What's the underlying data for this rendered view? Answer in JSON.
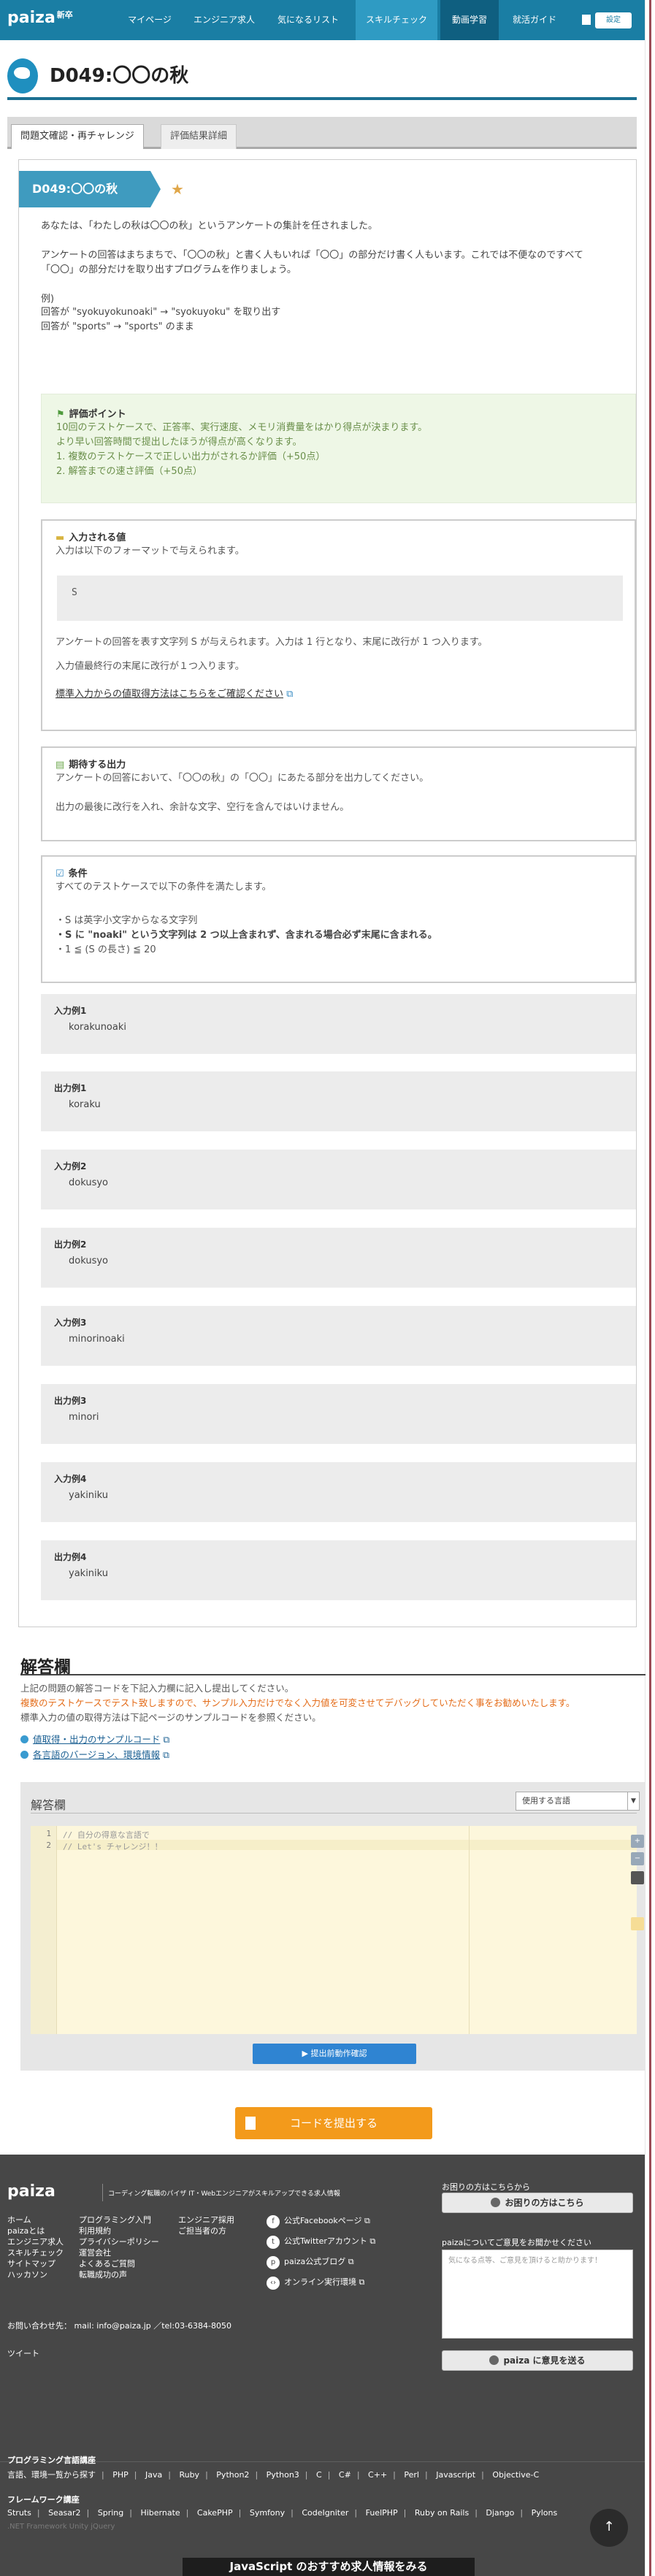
{
  "nav": {
    "logo": "paiza",
    "logo_sub": "新卒",
    "items": [
      "マイページ",
      "エンジニア求人",
      "気になるリスト",
      "スキルチェック",
      "動画学習",
      "就活ガイド"
    ],
    "settings": "設定"
  },
  "page": {
    "title": "D049:〇〇の秋",
    "tabs": [
      "問題文確認・再チャレンジ",
      "評価結果詳細"
    ]
  },
  "problem": {
    "ribbon": "D049:〇〇の秋",
    "intro": "あなたは、「わたしの秋は〇〇の秋」というアンケートの集計を任されました。",
    "desc1": "アンケートの回答はまちまちで、「〇〇の秋」と書く人もいれば「〇〇」の部分だけ書く人もいます。これでは不便なのですべて",
    "desc2": "「〇〇」の部分だけを取り出すプログラムを作りましょう。",
    "ex_head": "例)",
    "ex1": "回答が \"syokuyokunoaki\" → \"syokuyoku\" を取り出す",
    "ex2": "回答が \"sports\" → \"sports\" のまま",
    "eval": {
      "title": "評価ポイント",
      "line1": "10回のテストケースで、正答率、実行速度、メモリ消費量をはかり得点が決まります。",
      "line2": "より早い回答時間で提出したほうが得点が高くなります。",
      "line3": "1.  複数のテストケースで正しい出力がされるか評価（+50点）",
      "line4": "2.  解答までの速さ評価（+50点）"
    },
    "input": {
      "title": "入力される値",
      "line1": "入力は以下のフォーマットで与えられます。",
      "sample": "S",
      "line2": "アンケートの回答を表す文字列 S が与えられます。入力は 1 行となり、末尾に改行が 1 つ入ります。",
      "line3": "入力値最終行の末尾に改行が１つ入ります。",
      "link": "標準入力からの値取得方法はこちらをご確認ください"
    },
    "output": {
      "title": "期待する出力",
      "line1": "アンケートの回答において、「〇〇の秋」の「〇〇」にあたる部分を出力してください。",
      "line2": "出力の最後に改行を入れ、余計な文字、空行を含んではいけません。"
    },
    "cond": {
      "title": "条件",
      "line1": "すべてのテストケースで以下の条件を満たします。",
      "line2": "・S は英字小文字からなる文字列",
      "line3": "・S に \"noaki\" という文字列は 2 つ以上含まれず、含まれる場合必ず末尾に含まれる。",
      "line4": "・1 ≦ (S の長さ) ≦ 20"
    },
    "samples": [
      {
        "label": "入力例1",
        "value": "korakunoaki"
      },
      {
        "label": "出力例1",
        "value": "koraku"
      },
      {
        "label": "入力例2",
        "value": "dokusyo"
      },
      {
        "label": "出力例2",
        "value": "dokusyo"
      },
      {
        "label": "入力例3",
        "value": "minorinoaki"
      },
      {
        "label": "出力例3",
        "value": "minori"
      },
      {
        "label": "入力例4",
        "value": "yakiniku"
      },
      {
        "label": "出力例4",
        "value": "yakiniku"
      }
    ]
  },
  "answer": {
    "heading": "解答欄",
    "p1": "上記の問題の解答コードを下記入力欄に記入し提出してください。",
    "p2": "複数のテストケースでテスト致しますので、サンプル入力だけでなく入力値を可変させてデバッグしていただく事をお勧めいたします。",
    "p3": "標準入力の値の取得方法は下記ページのサンプルコードを参照ください。",
    "link1": "値取得・出力のサンプルコード",
    "link2": "各言語のバージョン、環境情報",
    "editor_label": "解答欄",
    "lang_select": "使用する言語",
    "code_lines": [
      "// 自分の得意な言語で",
      "// Let's チャレンジ！！"
    ],
    "run_button": "提出前動作確認",
    "submit_button": "コードを提出する"
  },
  "footer": {
    "logo": "paiza",
    "tagline": "コーディング転職のパイザ  IT・Webエンジニアがスキルアップできる求人情報",
    "col1": [
      "ホーム",
      "paizaとは",
      "エンジニア求人",
      "スキルチェック",
      "サイトマップ",
      "ハッカソン"
    ],
    "col2": [
      "プログラミング入門",
      "利用規約",
      "プライバシーポリシー",
      "運営会社",
      "よくあるご質問",
      "転職成功の声"
    ],
    "col3": [
      "エンジニア採用",
      "ご担当者の方"
    ],
    "social": [
      "公式Facebookページ",
      "公式Twitterアカウント",
      "paiza公式ブログ",
      "オンライン実行環境"
    ],
    "contact_label": "お困りの方はこちらから",
    "contact_button": "お困りの方はこちら",
    "feedback_label": "paizaについてご意見をお聞かせください",
    "feedback_placeholder": "気になる点等、ご意見を頂けると助かります！",
    "feedback_button": "paiza に意見を送る",
    "contact_info": "お問い合わせ先：  mail: info@paiza.jp ／tel:03-6384-8050",
    "tweet": "ツイート",
    "lang_head": "プログラミング言語講座",
    "langs": [
      "言語、環境一覧から探す",
      "PHP",
      "Java",
      "Ruby",
      "Python2",
      "Python3",
      "C",
      "C#",
      "C++",
      "Perl",
      "Javascript",
      "Objective-C"
    ],
    "fw_head": "フレームワーク講座",
    "fws": [
      "Struts",
      "Seasar2",
      "Spring",
      "Hibernate",
      "CakePHP",
      "Symfony",
      "CodeIgniter",
      "FuelPHP",
      "Ruby on Rails",
      "Django",
      "Pylons"
    ],
    "fws_dim": ".NET Framework   Unity   jQuery",
    "banner": "JavaScript のおすすめ求人情報をみる"
  }
}
